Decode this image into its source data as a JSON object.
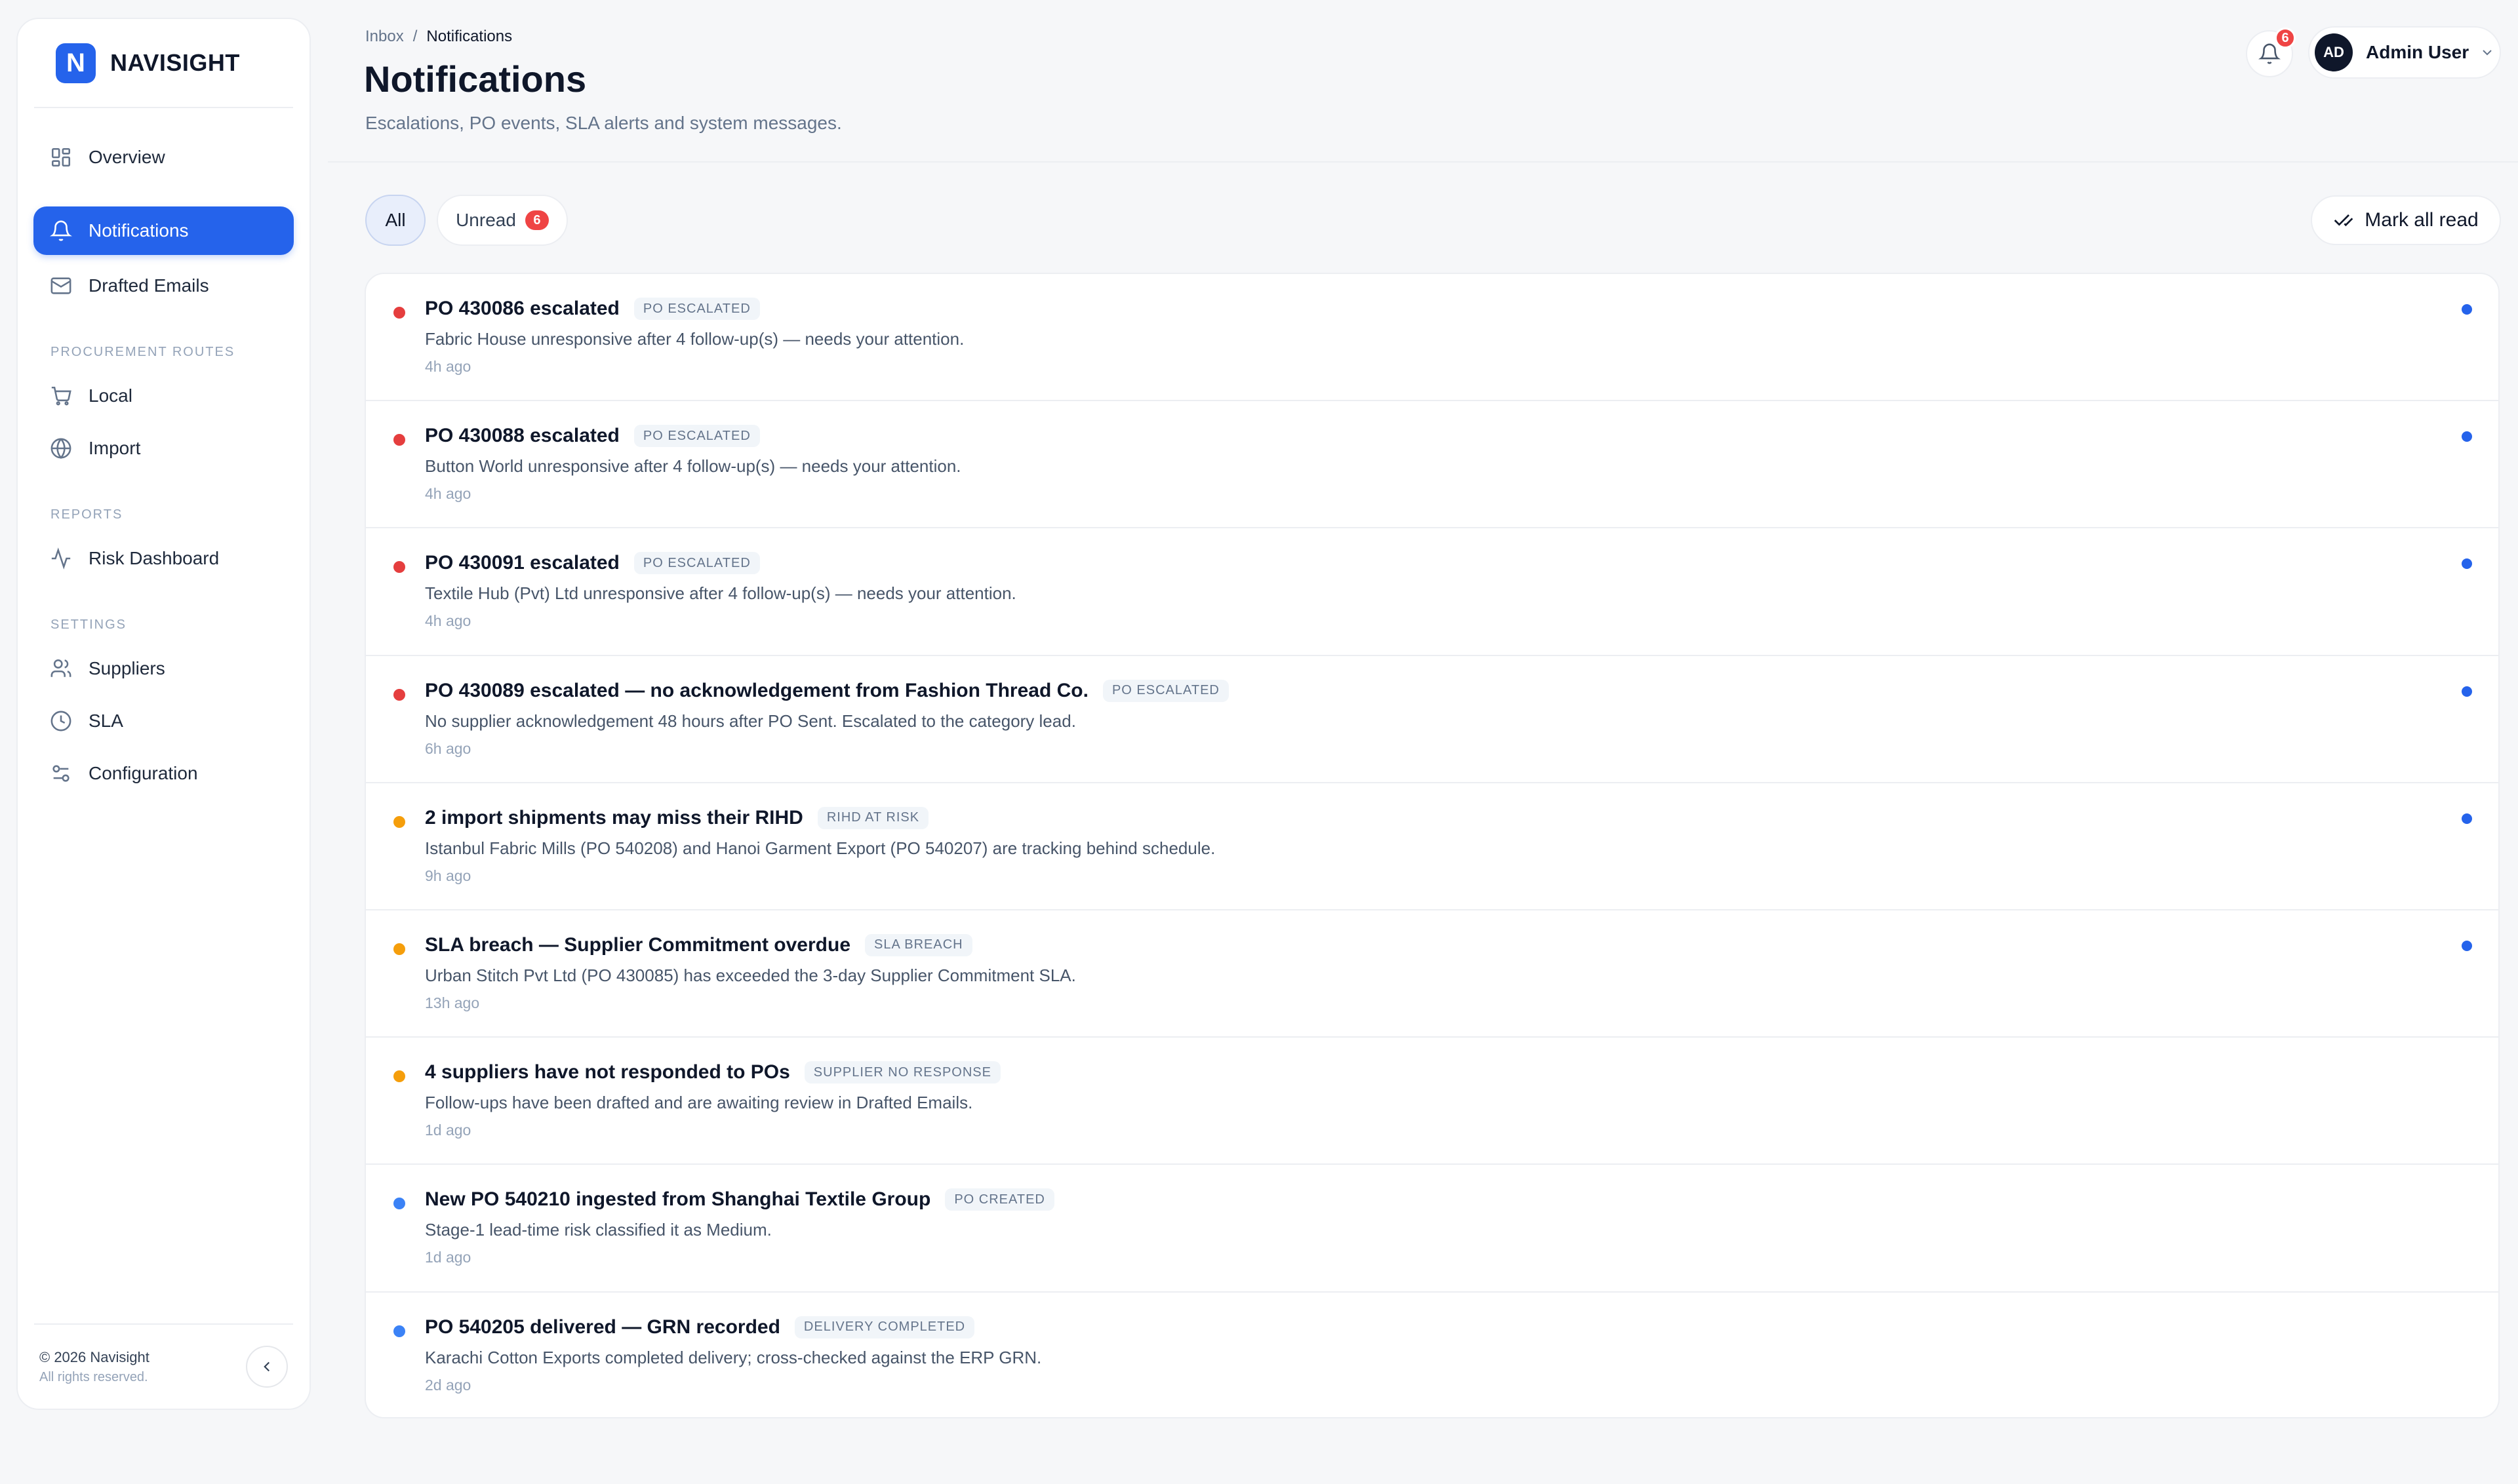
{
  "brand": {
    "logo_letter": "N",
    "name": "NAVISIGHT"
  },
  "sidebar": {
    "items": [
      {
        "label": "Overview",
        "icon": "grid-icon"
      },
      {
        "label": "Notifications",
        "icon": "bell-icon",
        "active": true
      },
      {
        "label": "Drafted Emails",
        "icon": "mail-icon"
      }
    ],
    "sections": [
      {
        "label": "PROCUREMENT ROUTES",
        "items": [
          {
            "label": "Local",
            "icon": "cart-icon"
          },
          {
            "label": "Import",
            "icon": "globe-icon"
          }
        ]
      },
      {
        "label": "REPORTS",
        "items": [
          {
            "label": "Risk Dashboard",
            "icon": "activity-icon"
          }
        ]
      },
      {
        "label": "SETTINGS",
        "items": [
          {
            "label": "Suppliers",
            "icon": "users-icon"
          },
          {
            "label": "SLA",
            "icon": "clock-icon"
          },
          {
            "label": "Configuration",
            "icon": "sliders-icon"
          }
        ]
      }
    ],
    "footer": {
      "copyright": "© 2026 Navisight",
      "rights": "All rights reserved."
    }
  },
  "header": {
    "breadcrumb": {
      "root": "Inbox",
      "separator": "/",
      "current": "Notifications"
    },
    "title": "Notifications",
    "subtitle": "Escalations, PO events, SLA alerts and system messages.",
    "bell_count": "6",
    "user": {
      "initials": "AD",
      "name": "Admin User"
    }
  },
  "filters": {
    "all_label": "All",
    "unread_label": "Unread",
    "unread_count": "6",
    "mark_all_label": "Mark all read"
  },
  "colors": {
    "accent": "#2563eb",
    "red": "#e53e3e",
    "amber": "#f59e0b",
    "blue": "#3b82f6"
  },
  "notifications": [
    {
      "title": "PO 430086 escalated",
      "tag": "PO ESCALATED",
      "body": "Fabric House unresponsive after 4 follow-up(s) — needs your attention.",
      "time": "4h ago",
      "severity": "red",
      "unread": true
    },
    {
      "title": "PO 430088 escalated",
      "tag": "PO ESCALATED",
      "body": "Button World unresponsive after 4 follow-up(s) — needs your attention.",
      "time": "4h ago",
      "severity": "red",
      "unread": true
    },
    {
      "title": "PO 430091 escalated",
      "tag": "PO ESCALATED",
      "body": "Textile Hub (Pvt) Ltd unresponsive after 4 follow-up(s) — needs your attention.",
      "time": "4h ago",
      "severity": "red",
      "unread": true
    },
    {
      "title": "PO 430089 escalated — no acknowledgement from Fashion Thread Co.",
      "tag": "PO ESCALATED",
      "body": "No supplier acknowledgement 48 hours after PO Sent. Escalated to the category lead.",
      "time": "6h ago",
      "severity": "red",
      "unread": true
    },
    {
      "title": "2 import shipments may miss their RIHD",
      "tag": "RIHD AT RISK",
      "body": "Istanbul Fabric Mills (PO 540208) and Hanoi Garment Export (PO 540207) are tracking behind schedule.",
      "time": "9h ago",
      "severity": "amber",
      "unread": true
    },
    {
      "title": "SLA breach — Supplier Commitment overdue",
      "tag": "SLA BREACH",
      "body": "Urban Stitch Pvt Ltd (PO 430085) has exceeded the 3-day Supplier Commitment SLA.",
      "time": "13h ago",
      "severity": "amber",
      "unread": true
    },
    {
      "title": "4 suppliers have not responded to POs",
      "tag": "SUPPLIER NO RESPONSE",
      "body": "Follow-ups have been drafted and are awaiting review in Drafted Emails.",
      "time": "1d ago",
      "severity": "amber",
      "unread": false
    },
    {
      "title": "New PO 540210 ingested from Shanghai Textile Group",
      "tag": "PO CREATED",
      "body": "Stage-1 lead-time risk classified it as Medium.",
      "time": "1d ago",
      "severity": "blue",
      "unread": false
    },
    {
      "title": "PO 540205 delivered — GRN recorded",
      "tag": "DELIVERY COMPLETED",
      "body": "Karachi Cotton Exports completed delivery; cross-checked against the ERP GRN.",
      "time": "2d ago",
      "severity": "blue",
      "unread": false
    }
  ]
}
